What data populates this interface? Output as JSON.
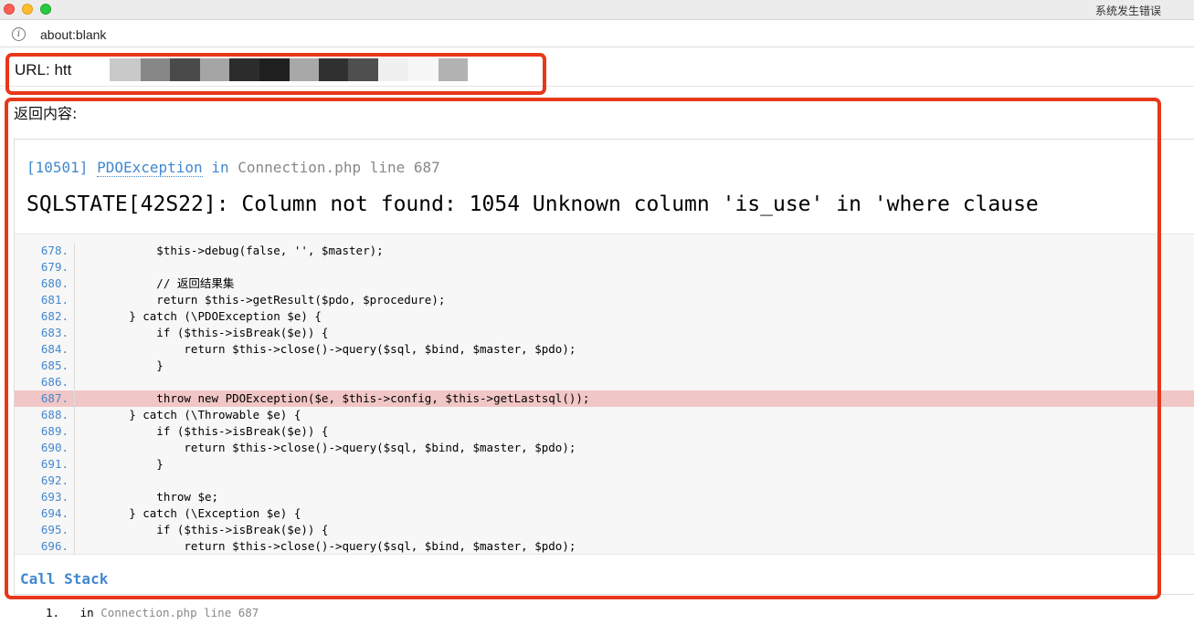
{
  "window": {
    "title": "系统发生错误"
  },
  "address_bar": {
    "url": "about:blank",
    "info_icon": "info-icon"
  },
  "request": {
    "url_label": "URL: htt"
  },
  "content_label": "返回内容:",
  "exception": {
    "code": "[10501]",
    "class": "PDOException",
    "in_word": "in",
    "location": "Connection.php line 687",
    "message": "SQLSTATE[42S22]: Column not found: 1054 Unknown column 'is_use' in 'where clause"
  },
  "source": {
    "highlight_line": "687.",
    "lines": [
      {
        "num": "678.",
        "text": "            $this->debug(false, '', $master);"
      },
      {
        "num": "679.",
        "text": ""
      },
      {
        "num": "680.",
        "text": "            // 返回结果集"
      },
      {
        "num": "681.",
        "text": "            return $this->getResult($pdo, $procedure);"
      },
      {
        "num": "682.",
        "text": "        } catch (\\PDOException $e) {"
      },
      {
        "num": "683.",
        "text": "            if ($this->isBreak($e)) {"
      },
      {
        "num": "684.",
        "text": "                return $this->close()->query($sql, $bind, $master, $pdo);"
      },
      {
        "num": "685.",
        "text": "            }"
      },
      {
        "num": "686.",
        "text": ""
      },
      {
        "num": "687.",
        "text": "            throw new PDOException($e, $this->config, $this->getLastsql());"
      },
      {
        "num": "688.",
        "text": "        } catch (\\Throwable $e) {"
      },
      {
        "num": "689.",
        "text": "            if ($this->isBreak($e)) {"
      },
      {
        "num": "690.",
        "text": "                return $this->close()->query($sql, $bind, $master, $pdo);"
      },
      {
        "num": "691.",
        "text": "            }"
      },
      {
        "num": "692.",
        "text": ""
      },
      {
        "num": "693.",
        "text": "            throw $e;"
      },
      {
        "num": "694.",
        "text": "        } catch (\\Exception $e) {"
      },
      {
        "num": "695.",
        "text": "            if ($this->isBreak($e)) {"
      },
      {
        "num": "696.",
        "text": "                return $this->close()->query($sql, $bind, $master, $pdo);"
      }
    ]
  },
  "call_stack": {
    "title": "Call Stack",
    "items": [
      {
        "num": "1.",
        "in_word": "in",
        "location": "Connection.php line 687"
      }
    ]
  },
  "colors": {
    "highlight_border": "#e8371b",
    "link_blue": "#4288ce",
    "error_line_bg": "#f1c6c6"
  }
}
